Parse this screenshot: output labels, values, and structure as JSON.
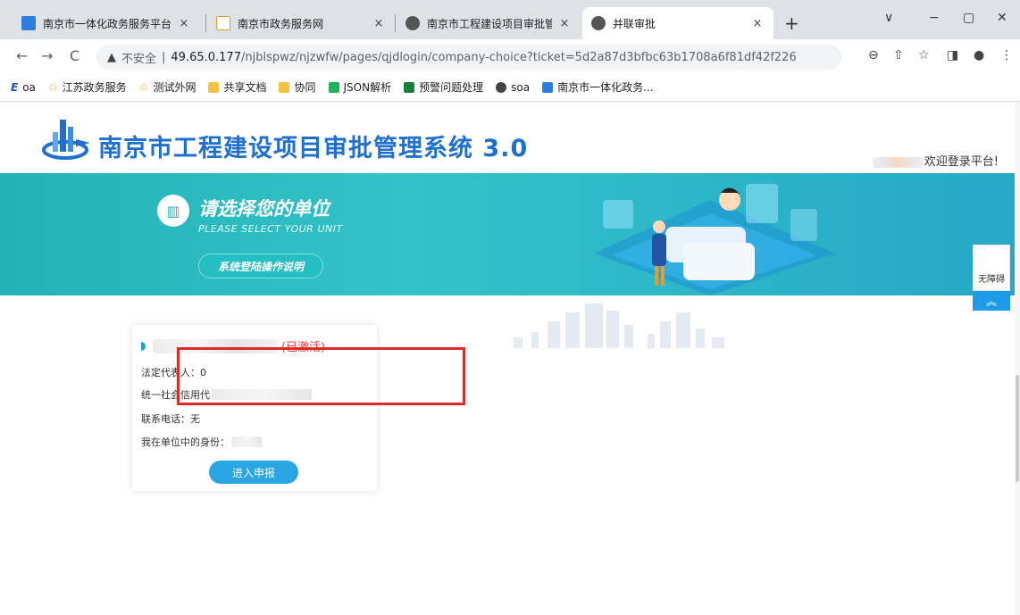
{
  "browser": {
    "tabs": [
      {
        "title": "南京市一体化政务服务平台",
        "close": "×",
        "active": false
      },
      {
        "title": "南京市政务服务网",
        "close": "×",
        "active": false
      },
      {
        "title": "南京市工程建设项目审批管理系",
        "close": "×",
        "active": false
      },
      {
        "title": "并联审批",
        "close": "×",
        "active": true
      }
    ],
    "new_tab": "+",
    "window_controls": {
      "menu": "∨",
      "minimize": "−",
      "restore": "▢",
      "close": "✕"
    },
    "nav": {
      "back": "←",
      "forward": "→",
      "reload": "C"
    },
    "url": {
      "warning_icon": "▲",
      "insecure_label": "不安全",
      "separator": "|",
      "host": "49.65.0.177",
      "path": "/njblspwz/njzwfw/pages/qjdlogin/company-choice?ticket=5d2a87d3bfbc63b1708a6f81df42f226"
    },
    "toolbar_icons": [
      "zoom-icon",
      "share-icon",
      "star-icon",
      "sidepanel-icon",
      "profile-icon",
      "menu-icon"
    ],
    "toolbar_glyphs": [
      "⊖",
      "⇧",
      "☆",
      "◨",
      "●",
      "⋮"
    ],
    "bookmarks": [
      {
        "label": "oa",
        "icon": "E",
        "color": "#1a56c4"
      },
      {
        "label": "江苏政务服务",
        "icon": "♲",
        "color": "#e89a2b"
      },
      {
        "label": "测试外网",
        "icon": "♲",
        "color": "#e89a2b"
      },
      {
        "label": "共享文档",
        "icon": "folder",
        "color": "#f5c242"
      },
      {
        "label": "协同",
        "icon": "folder",
        "color": "#f5c242"
      },
      {
        "label": "JSON解析",
        "icon": "json",
        "color": "#1fb35a"
      },
      {
        "label": "预警问题处理",
        "icon": "sheet",
        "color": "#188038"
      },
      {
        "label": "soa",
        "icon": "globe",
        "color": "#444444"
      },
      {
        "label": "南京市一体化政务...",
        "icon": "gov",
        "color": "#2d7de0"
      }
    ]
  },
  "page": {
    "site_title": "南京市工程建设项目审批管理系统 3.0",
    "welcome": "欢迎登录平台!",
    "banner": {
      "title": "请选择您的单位",
      "subtitle": "PLEASE SELECT YOUR UNIT",
      "guide_button": "系统登陆操作说明"
    },
    "side": {
      "accessibility": "无障碍",
      "to_top": "︽"
    },
    "card": {
      "status": "(已激活)",
      "legal_rep": "法定代表人：0",
      "credit_code_label": "统一社会信用代",
      "phone": "联系电话：无",
      "role_label": "我在单位中的身份："
    },
    "enter_button": "进入申报"
  },
  "colors": {
    "brand": "#1f6fd1",
    "banner": "#2bb4b9",
    "button": "#29a5e3",
    "status": "#e0453b",
    "highlight": "#e02a2a"
  }
}
